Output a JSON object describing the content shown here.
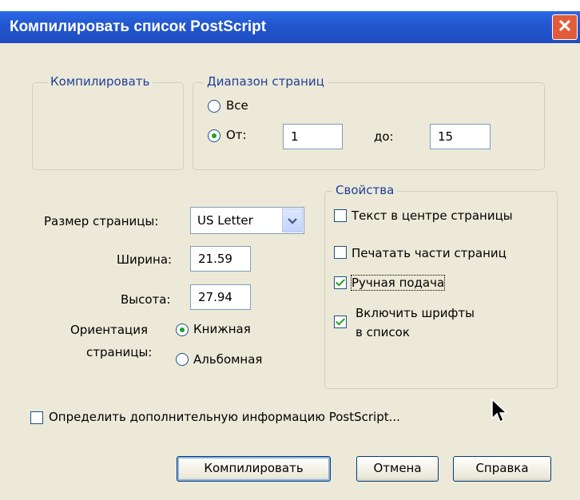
{
  "window": {
    "title": "Компилировать список PostScript",
    "close_symbol": "✕"
  },
  "compile_group": {
    "legend": "Компилировать"
  },
  "range_group": {
    "legend": "Диапазон страниц",
    "all_label": "Все",
    "from_label": "От:",
    "from_value": "1",
    "to_label": "до:",
    "to_value": "15",
    "selected": "from"
  },
  "page": {
    "size_label": "Размер страницы:",
    "size_value": "US Letter",
    "width_label": "Ширина:",
    "width_value": "21.59",
    "height_label": "Высота:",
    "height_value": "27.94",
    "orientation_label_1": "Ориентация",
    "orientation_label_2": "страницы:",
    "portrait_label": "Книжная",
    "landscape_label": "Альбомная",
    "orientation_selected": "portrait"
  },
  "properties": {
    "legend": "Свойства",
    "center_text": {
      "label": "Текст в центре страницы",
      "checked": false
    },
    "print_parts": {
      "label": "Печатать части страниц",
      "checked": false
    },
    "manual_feed": {
      "label": "Ручная подача",
      "checked": true
    },
    "include_fonts": {
      "label_1": "Включить шрифты",
      "label_2": "в список",
      "checked": true
    }
  },
  "extra_info": {
    "label": "Определить дополнительную информацию PostScript...",
    "checked": false
  },
  "buttons": {
    "compile": "Компилировать",
    "cancel": "Отмена",
    "help": "Справка"
  },
  "icons": {
    "dropdown": "chevron-down-icon",
    "cursor": "mouse-pointer-icon"
  }
}
